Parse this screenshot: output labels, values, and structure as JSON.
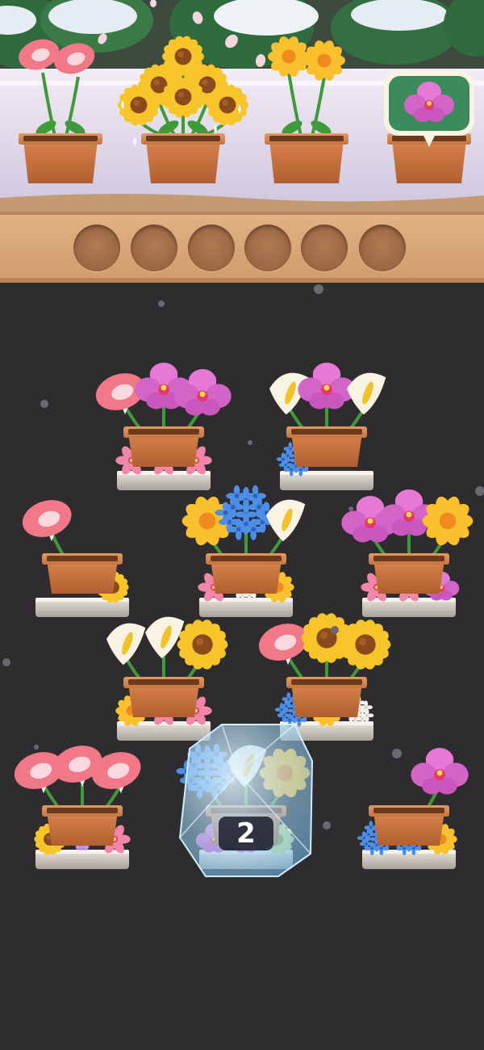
{
  "game": {
    "order_shelf": {
      "pots": [
        {
          "flower": "pink-petunia",
          "count": 2
        },
        {
          "flower": "sunflower",
          "count": 6,
          "status": "completing"
        },
        {
          "flower": "yellow-daisy",
          "count": 2
        },
        {
          "flower": "orchid",
          "count": 0,
          "request_bubble": "orchid"
        }
      ]
    },
    "holding_slots": {
      "total": 6,
      "filled": 0
    },
    "board": {
      "pots": [
        {
          "id": "pot-a",
          "flowers": [
            "pink-petunia",
            "orchid",
            "orchid"
          ],
          "tray": [
            "pink-camellia",
            "pink-camellia",
            "pink-camellia"
          ]
        },
        {
          "id": "pot-b",
          "flowers": [
            "calla-lily",
            "orchid",
            "calla-lily"
          ],
          "tray": [
            "blue-hydrangea"
          ]
        },
        {
          "id": "pot-c",
          "flowers": [
            "pink-petunia"
          ],
          "tray": [
            "sunflower"
          ]
        },
        {
          "id": "pot-d",
          "flowers": [
            "yellow-daisy",
            "blue-hydrangea",
            "calla-lily"
          ],
          "tray": [
            "pink-camellia",
            "white-hydrangea",
            "yellow-daisy"
          ]
        },
        {
          "id": "pot-e",
          "flowers": [
            "orchid",
            "orchid",
            "yellow-daisy"
          ],
          "tray": [
            "pink-camellia",
            "pink-camellia",
            "orchid"
          ]
        },
        {
          "id": "pot-f",
          "flowers": [
            "calla-lily",
            "calla-lily",
            "sunflower"
          ],
          "tray": [
            "yellow-daisy",
            "pink-camellia",
            "pink-camellia"
          ]
        },
        {
          "id": "pot-g",
          "flowers": [
            "pink-petunia",
            "sunflower",
            "sunflower"
          ],
          "tray": [
            "blue-hydrangea",
            "yellow-daisy",
            "white-hydrangea"
          ]
        },
        {
          "id": "pot-h",
          "flowers": [
            "pink-petunia",
            "pink-petunia",
            "pink-petunia"
          ],
          "tray": [
            "sunflower",
            "lilac-hyacinth",
            "pink-camellia"
          ]
        },
        {
          "id": "pot-i",
          "flowers": [
            "blue-hydrangea",
            "calla-lily",
            "yellow-daisy"
          ],
          "tray": [
            "orchid",
            "orchid",
            "green-daisy"
          ],
          "locked": true,
          "ice_count": "2"
        },
        {
          "id": "pot-j",
          "flowers": [
            "orchid"
          ],
          "tray": [
            "blue-hydrangea",
            "blue-hydrangea",
            "yellow-daisy"
          ]
        }
      ]
    },
    "colors": {
      "background": "#2e2c2f",
      "wood": "#d9a779",
      "slot": "#9b6642",
      "pot": "#c8703f",
      "ice": "#a9dcf7"
    }
  }
}
